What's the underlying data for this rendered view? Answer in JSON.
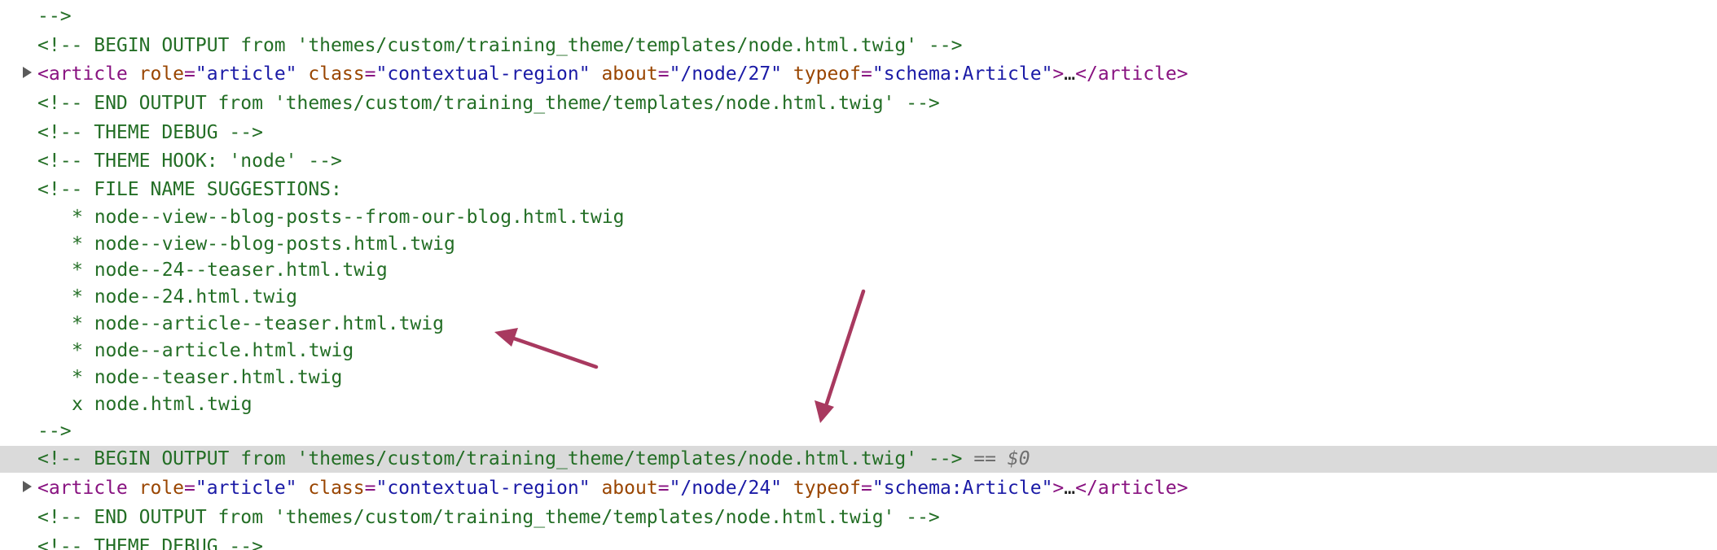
{
  "devtools": {
    "lines": {
      "l0": "-->",
      "l1": "<!-- BEGIN OUTPUT from 'themes/custom/training_theme/templates/node.html.twig' -->",
      "l2": {
        "open": "<article",
        "role_name": "role",
        "role_value": "\"article\"",
        "class_name": "class",
        "class_value": "\"contextual-region\"",
        "about_name": "about",
        "about_value": "\"/node/27\"",
        "typeof_name": "typeof",
        "typeof_value": "\"schema:Article\"",
        "gt": ">",
        "ellipsis": "…",
        "close": "</article>"
      },
      "l3": "<!-- END OUTPUT from 'themes/custom/training_theme/templates/node.html.twig' -->",
      "l4": "<!-- THEME DEBUG -->",
      "l5": "<!-- THEME HOOK: 'node' -->",
      "l6": "<!-- FILE NAME SUGGESTIONS:",
      "suggestions": [
        "* node--view--blog-posts--from-our-blog.html.twig",
        "* node--view--blog-posts.html.twig",
        "* node--24--teaser.html.twig",
        "* node--24.html.twig",
        "* node--article--teaser.html.twig",
        "* node--article.html.twig",
        "* node--teaser.html.twig",
        "x node.html.twig"
      ],
      "l15": "-->",
      "l16": "<!-- BEGIN OUTPUT from 'themes/custom/training_theme/templates/node.html.twig' -->",
      "l16_selected": " == $0",
      "l17": {
        "open": "<article",
        "role_name": "role",
        "role_value": "\"article\"",
        "class_name": "class",
        "class_value": "\"contextual-region\"",
        "about_name": "about",
        "about_value": "\"/node/24\"",
        "typeof_name": "typeof",
        "typeof_value": "\"schema:Article\"",
        "gt": ">",
        "ellipsis": "…",
        "close": "</article>"
      },
      "l18": "<!-- END OUTPUT from 'themes/custom/training_theme/templates/node.html.twig' -->",
      "l19": "<!-- THEME DEBUG -->"
    },
    "colors": {
      "comment": "#236e25",
      "tag": "#881280",
      "attr_name": "#994500",
      "attr_value": "#1a1aa6",
      "selection": "#dadada",
      "annotation_arrow": "#a8395f"
    }
  }
}
